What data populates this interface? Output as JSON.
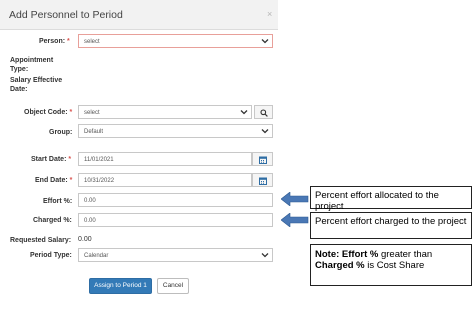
{
  "modal": {
    "title": "Add Personnel to Period",
    "close_glyph": "×"
  },
  "form": {
    "person": {
      "label": "Person:",
      "required_mark": "*",
      "value": "select"
    },
    "appointment_type": {
      "label_line1": "Appointment",
      "label_line2": "Type:"
    },
    "salary_effective_date": {
      "label_line1": "Salary Effective",
      "label_line2": "Date:"
    },
    "object_code": {
      "label": "Object Code:",
      "required_mark": "*",
      "value": "select"
    },
    "group": {
      "label": "Group:",
      "value": "Default"
    },
    "start_date": {
      "label": "Start Date:",
      "required_mark": "*",
      "value": "11/01/2021"
    },
    "end_date": {
      "label": "End Date:",
      "required_mark": "*",
      "value": "10/31/2022"
    },
    "effort": {
      "label": "Effort %:",
      "value": "0.00"
    },
    "charged": {
      "label": "Charged %:",
      "value": "0.00"
    },
    "requested_salary": {
      "label": "Requested Salary:",
      "value": "0.00"
    },
    "period_type": {
      "label": "Period Type:",
      "value": "Calendar"
    }
  },
  "buttons": {
    "assign": "Assign to Period 1",
    "cancel": "Cancel"
  },
  "annotations": {
    "effort_callout": "Percent effort allocated to the project",
    "charged_callout": "Percent effort charged to the project",
    "note_bold1": "Note: Effort %",
    "note_text1": " greater than",
    "note_bold2": "Charged %",
    "note_text2": " is Cost Share"
  },
  "icons": {
    "close": "close-icon",
    "chevron": "chevron-down-icon",
    "calendar": "calendar-icon",
    "search": "search-icon",
    "arrow": "left-arrow-icon"
  },
  "colors": {
    "primary": "#337ab7",
    "required": "#d9534f",
    "error_border": "#e8a09a",
    "arrow": "#4a78b5",
    "calendar_icon": "#2e6da4"
  }
}
